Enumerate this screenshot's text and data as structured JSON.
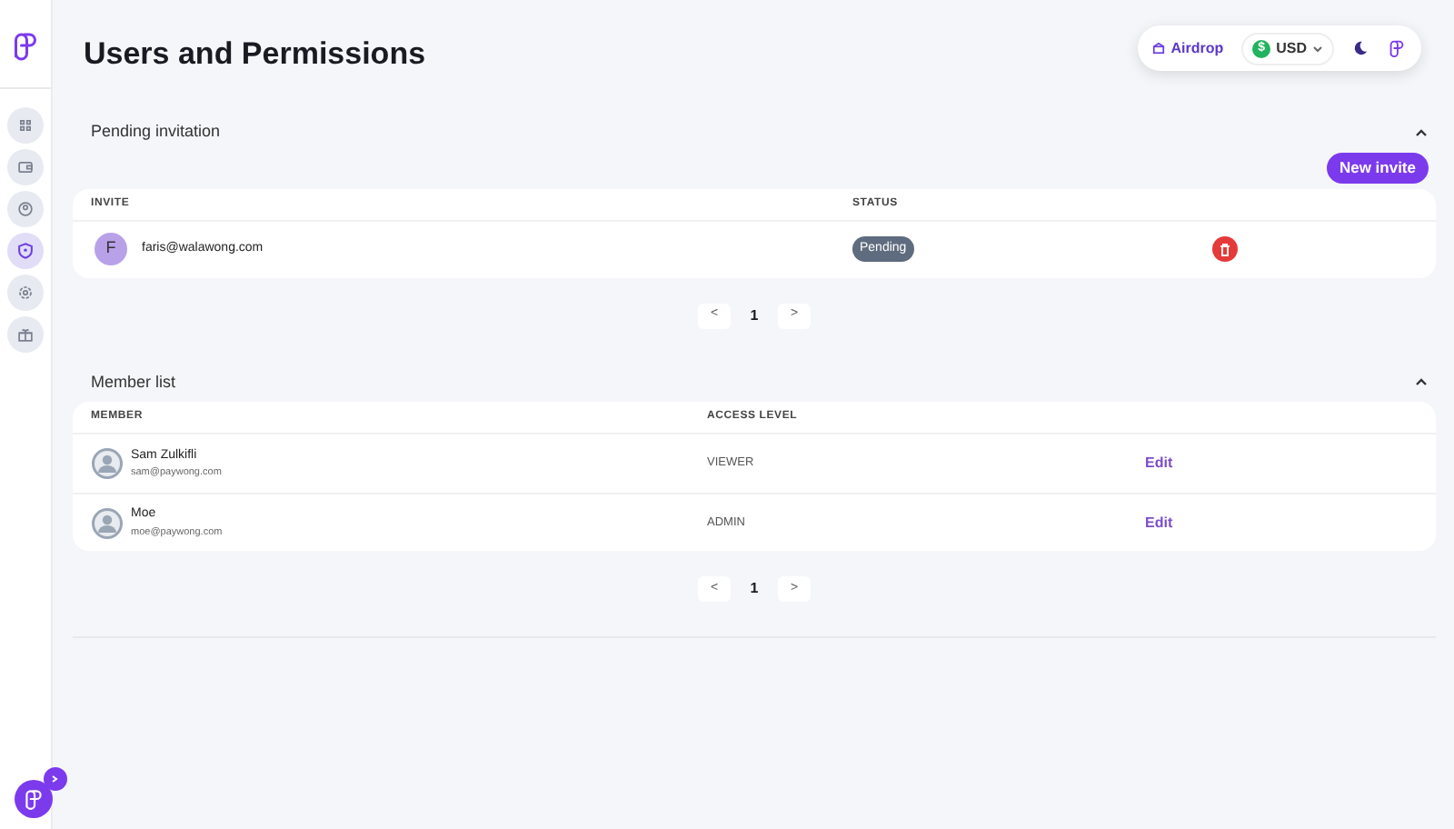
{
  "page_title": "Users and Permissions",
  "sidebar": {
    "items": [
      {
        "kind": "grid",
        "selected": false
      },
      {
        "kind": "wallet",
        "selected": false
      },
      {
        "kind": "user",
        "selected": false
      },
      {
        "kind": "shield",
        "selected": true
      },
      {
        "kind": "gear",
        "selected": false
      },
      {
        "kind": "gift",
        "selected": false
      }
    ]
  },
  "top_bar": {
    "airdrop": "Airdrop",
    "currency_symbol": "$",
    "currency": "USD"
  },
  "pending": {
    "title": "Pending invitation",
    "expanded": true,
    "new_button": "New invite",
    "columns": [
      "INVITE",
      "STATUS"
    ],
    "rows": [
      {
        "initial": "F",
        "email": "faris@walawong.com",
        "status": "Pending"
      }
    ],
    "pagination": {
      "prev": "<",
      "page": "1",
      "next": ">"
    }
  },
  "members": {
    "title": "Member list",
    "expanded": true,
    "columns": [
      "MEMBER",
      "ACCESS LEVEL"
    ],
    "rows": [
      {
        "name": "Sam Zulkifli",
        "email": "sam@paywong.com",
        "access": "VIEWER",
        "action": "Edit"
      },
      {
        "name": "Moe",
        "email": "moe@paywong.com",
        "access": "ADMIN",
        "action": "Edit"
      }
    ],
    "pagination": {
      "prev": "<",
      "page": "1",
      "next": ">"
    }
  }
}
